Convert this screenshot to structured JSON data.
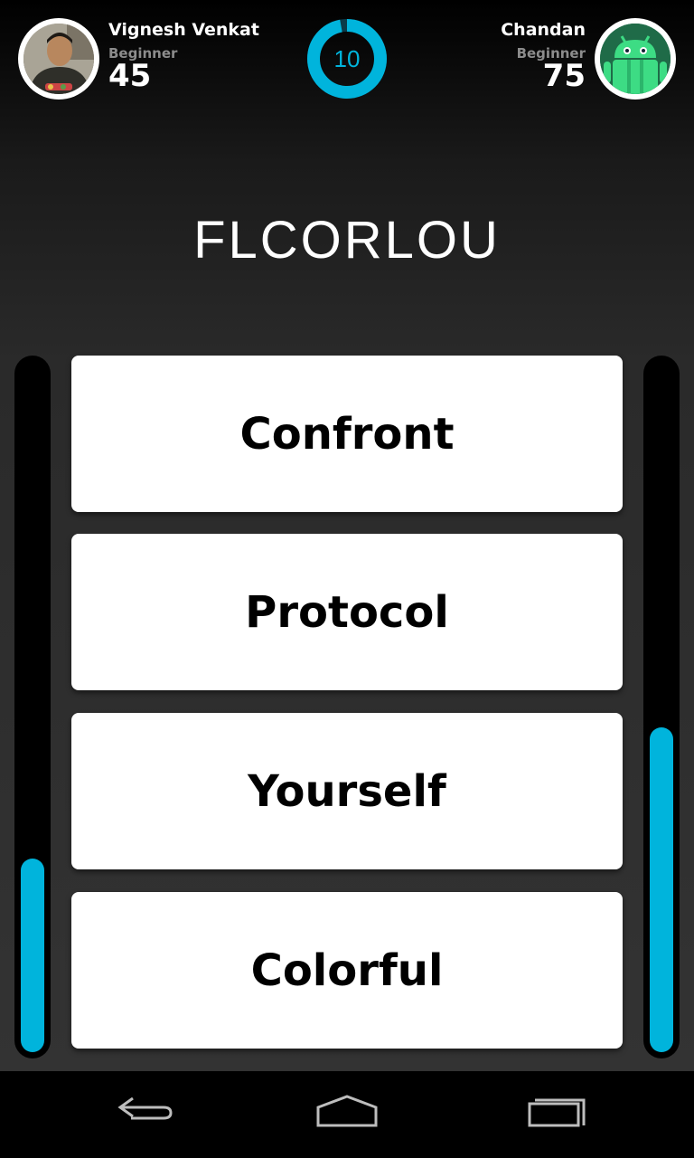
{
  "players": {
    "left": {
      "name": "Vignesh Venkat",
      "level": "Beginner",
      "score": "45",
      "progress": 0.28
    },
    "right": {
      "name": "Chandan",
      "level": "Beginner",
      "score": "75",
      "progress": 0.47
    }
  },
  "timer": {
    "value": "10",
    "remaining_fraction": 0.97
  },
  "puzzle": {
    "scrambled_word": "FLCORLOU"
  },
  "options": [
    "Confront",
    "Protocol",
    "Yourself",
    "Colorful"
  ],
  "colors": {
    "accent": "#00b4dc",
    "card": "#ffffff",
    "meter_track": "#000000"
  },
  "navbar": {
    "icons": [
      "back-icon",
      "home-icon",
      "recent-apps-icon"
    ]
  }
}
